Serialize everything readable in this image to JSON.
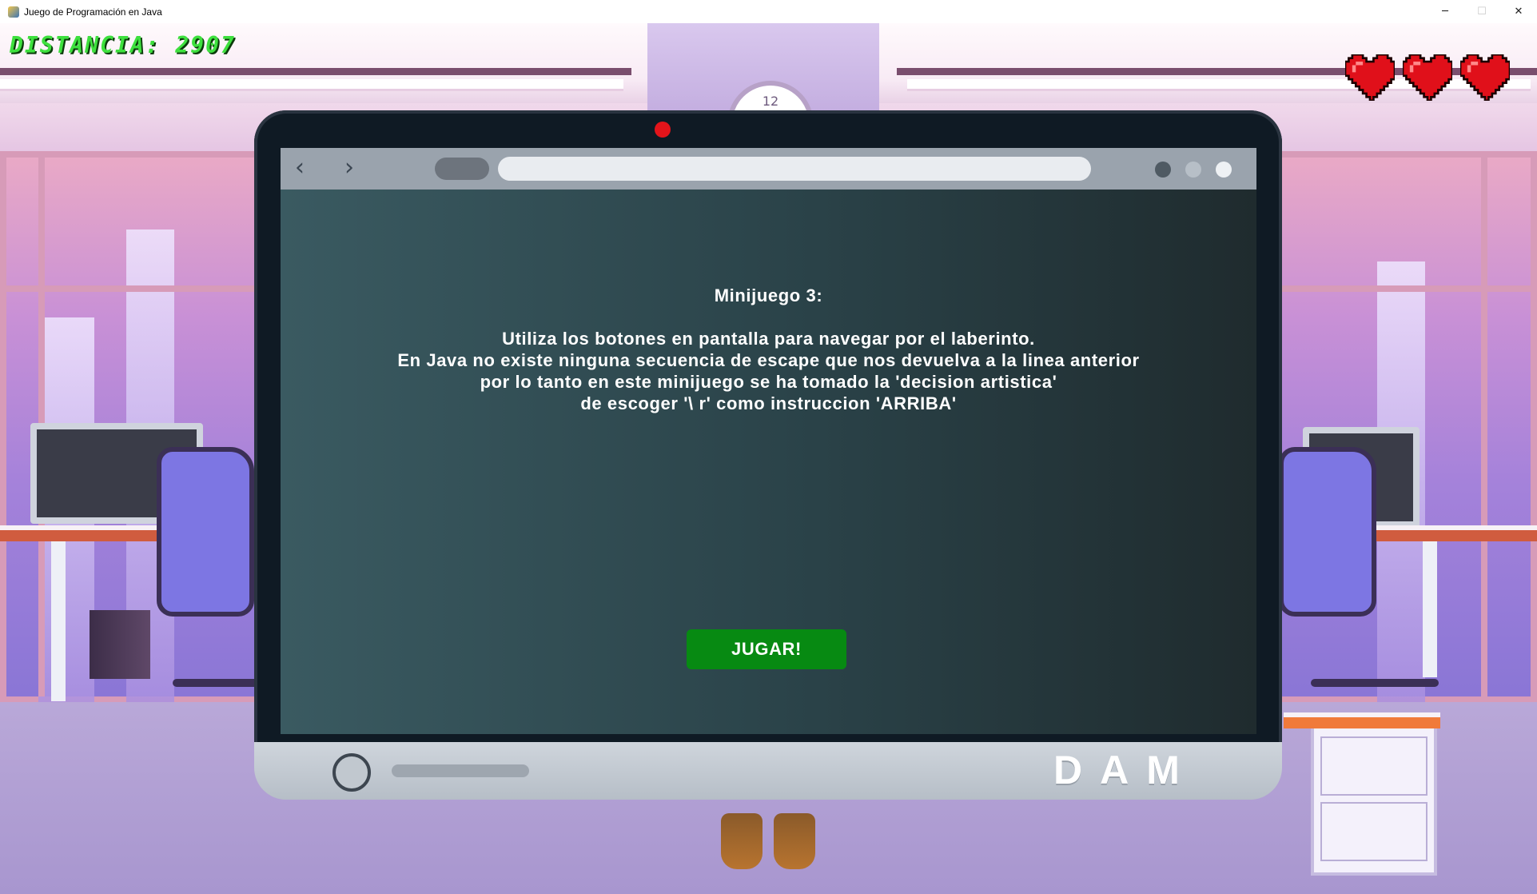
{
  "window": {
    "title": "Juego de Programación en Java",
    "controls": {
      "minimize": "─",
      "maximize": "☐",
      "close": "✕"
    }
  },
  "hud": {
    "distance_text": "DISTANCIA: 2907",
    "lives": 3,
    "heart_color": "#e0101a"
  },
  "background": {
    "clock_label": "12"
  },
  "laptop": {
    "browser": {
      "back": "‹",
      "forward": "›"
    },
    "dialog": {
      "title": "Minijuego 3:",
      "lines": [
        "Utiliza los botones en pantalla para navegar por el laberinto.",
        "En Java no existe ninguna secuencia de escape que nos devuelva a la linea anterior",
        "por lo tanto en este minijuego se ha tomado la 'decision artistica'",
        "de escoger '\\ r' como instruccion 'ARRIBA'"
      ],
      "play_button": "JUGAR!",
      "play_button_color": "#078a12"
    },
    "brand": "DAM",
    "camera_color": "#e3141a"
  }
}
